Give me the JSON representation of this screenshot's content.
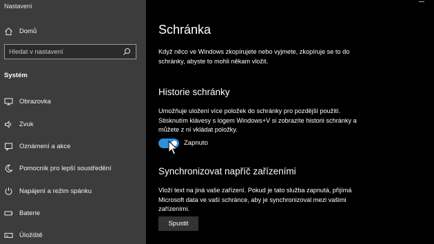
{
  "window": {
    "title": "Nastavení"
  },
  "sidebar": {
    "home": {
      "label": "Domů",
      "icon": "home-icon"
    },
    "search": {
      "placeholder": "Hledat v nastavení",
      "icon": "search-icon"
    },
    "section_title": "Systém",
    "items": [
      {
        "label": "Obrazovka",
        "icon": "monitor-icon"
      },
      {
        "label": "Zvuk",
        "icon": "speaker-icon"
      },
      {
        "label": "Oznámení a akce",
        "icon": "notification-icon"
      },
      {
        "label": "Pomocník pro lepší soustředění",
        "icon": "moon-icon"
      },
      {
        "label": "Napájení a režim spánku",
        "icon": "power-icon"
      },
      {
        "label": "Baterie",
        "icon": "battery-icon"
      },
      {
        "label": "Úložiště",
        "icon": "storage-icon"
      }
    ]
  },
  "main": {
    "title": "Schránka",
    "intro": "Když něco ve Windows zkopírujete nebo vyjmete, zkopíruje se to do schránky, abyste to mohli někam vložit.",
    "history": {
      "heading": "Historie schránky",
      "description": "Umožňuje uložení více položek do schránky pro pozdější použití. Stisknutím klávesy s logem Windows+V si zobrazíte historii schránky a můžete z ní vkládat položky.",
      "toggle_state": "Zapnuto",
      "toggle_on": true
    },
    "sync": {
      "heading": "Synchronizovat napříč zařízeními",
      "description": "Vloží text na jiná vaše zařízení. Pokud je tato služba zapnutá, přijímá Microsoft data ve vaší schránce, aby je synchronizoval mezi vašimi zařízeními.",
      "button": "Spustit"
    }
  },
  "colors": {
    "accent": "#2f8fd8",
    "sidebar_bg": "#3c3c3c",
    "main_bg": "#000000"
  }
}
